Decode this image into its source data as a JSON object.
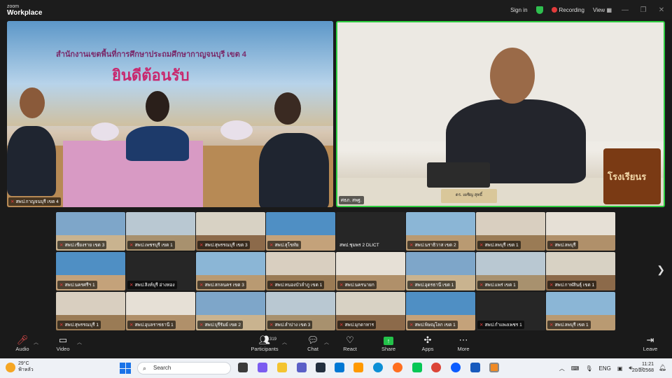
{
  "topbar": {
    "logo_line1": "zoom",
    "logo_line2": "Workplace",
    "sign_in": "Sign in",
    "recording": "Recording",
    "view": "View"
  },
  "main": {
    "left_banner_line1": "สำนักงานเขตพื้นที่การศึกษาประถมศึกษากาญจนบุรี เขต 4",
    "left_banner_line2": "ยินดีต้อนรับ",
    "left_label": "สพป.กาญจนบุรี เขต 4",
    "right_label": "ศธภ. สพฐ.",
    "right_sign": "โรงเรียนร",
    "right_nametag": "ดร. เผชิญ สุทธิ์"
  },
  "gallery": {
    "rows": [
      [
        "สพป.เชียงราย เขต 3",
        "สพป.เพชรบุรี เขต 1",
        "สพป.สุพรรณบุรี เขต 3",
        "สพป.สุโขทัย",
        "สพป.ชุมพร 2 DLICT",
        "สพป.นราธิวาส เขต 2",
        "สพป.ลพบุรี เขต 1",
        "สพป.ลพบุรี"
      ],
      [
        "สพป.นครศรีฯ 1",
        "สพป.สิงห์บุรี อ่างทอง",
        "สพป.สกลนคร เขต 3",
        "สพป.หนองบัวลำภู เขต 1",
        "สพป.นครนายก",
        "สพป.อุดรธานี เขต 1",
        "สพป.แพร่ เขต 1",
        "สพป.กาฬสินธุ์ เขต 1"
      ],
      [
        "สพป.สุพรรณบุรี 1",
        "สพป.อุบลราชธานี 1",
        "สพป.บุรีรัมย์ เขต 2",
        "สพป.ลำปาง เขต 3",
        "สพป.มุกดาหาร",
        "สพป.พิษณุโลก เขต 1",
        "สพป.กำแพงเพชร 1",
        "สพป.ลพบุรี เขต 1"
      ]
    ]
  },
  "toolbar": {
    "audio": "Audio",
    "video": "Video",
    "participants": "Participants",
    "participants_count": "319",
    "chat": "Chat",
    "react": "React",
    "share": "Share",
    "apps": "Apps",
    "more": "More",
    "leave": "Leave"
  },
  "taskbar": {
    "temp": "29°C",
    "weather": "ฟ้าหลัว",
    "search_placeholder": "Search",
    "lang": "ENG",
    "time": "11:21",
    "date": "20/2/2568"
  },
  "colors": {
    "active_speaker_border": "#2ecc40",
    "muted_mic": "#e23b3b",
    "share_green": "#23c24a",
    "leave_red": "#e84c4c"
  }
}
